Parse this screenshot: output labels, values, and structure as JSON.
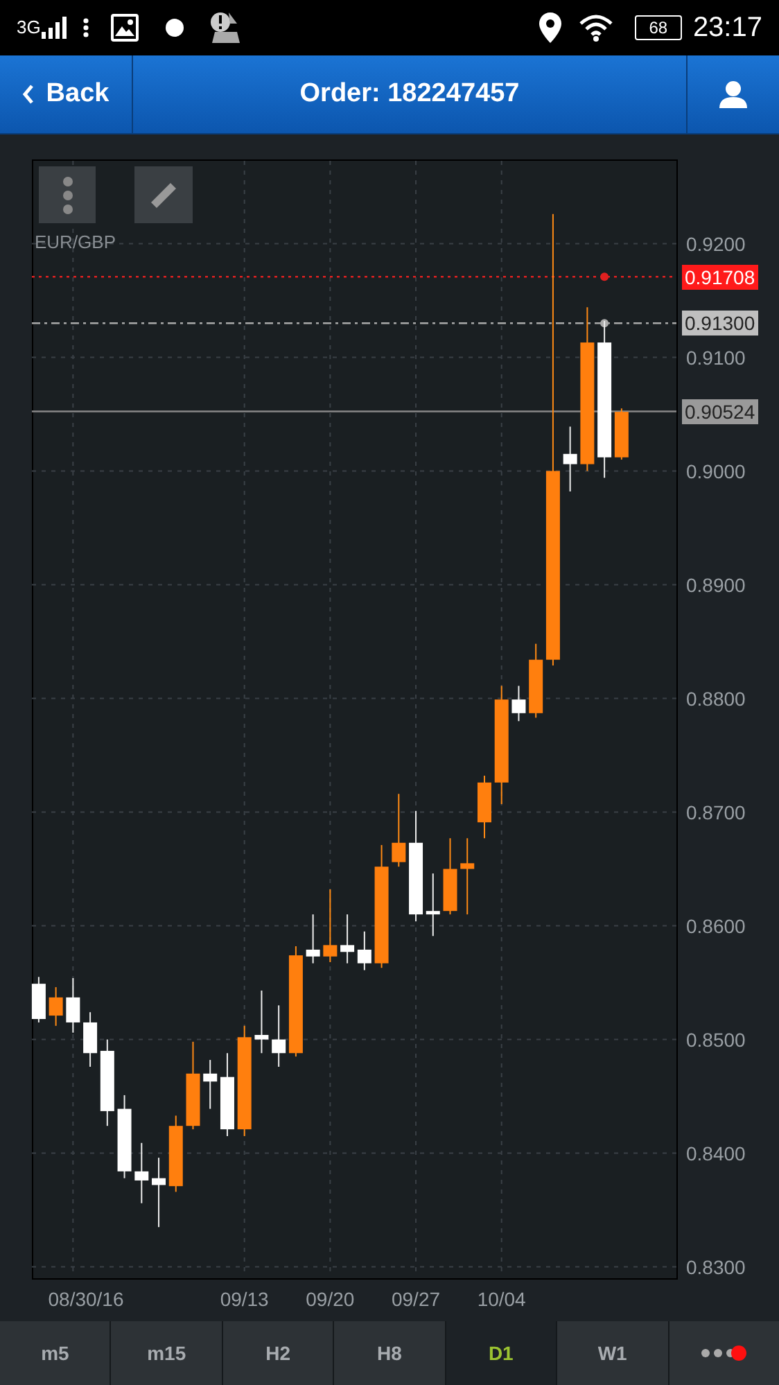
{
  "status_bar": {
    "network": "3G",
    "battery": "68",
    "time": "23:17"
  },
  "header": {
    "back": "Back",
    "title": "Order: 182247457"
  },
  "chart": {
    "symbol": "EUR/GBP",
    "price_markers": [
      {
        "label": "0.91708",
        "kind": "alert"
      },
      {
        "label": "0.91300",
        "kind": "order"
      },
      {
        "label": "0.90524",
        "kind": "current"
      }
    ],
    "chart_data": {
      "type": "candlestick",
      "ylim": [
        0.829,
        0.9274
      ],
      "grid": true,
      "categories": [
        null,
        null,
        "08/30/16",
        null,
        null,
        null,
        null,
        null,
        null,
        null,
        null,
        null,
        "09/13",
        null,
        null,
        null,
        null,
        "09/20",
        null,
        null,
        null,
        null,
        "09/27",
        null,
        null,
        null,
        null,
        "10/04",
        null,
        null,
        null,
        null,
        null,
        null,
        null
      ],
      "ref_lines": [
        {
          "axis": "y",
          "value": 0.91708,
          "color": "#e02020"
        },
        {
          "axis": "y",
          "value": 0.913,
          "color": "#aaaaaa"
        },
        {
          "axis": "y",
          "value": 0.90524,
          "color": "#888888"
        }
      ],
      "yticks": [
        {
          "value": 0.92,
          "label": "0.9200"
        },
        {
          "value": 0.91,
          "label": "0.9100"
        },
        {
          "value": 0.9,
          "label": "0.9000"
        },
        {
          "value": 0.89,
          "label": "0.8900"
        },
        {
          "value": 0.88,
          "label": "0.8800"
        },
        {
          "value": 0.87,
          "label": "0.8700"
        },
        {
          "value": 0.86,
          "label": "0.8600"
        },
        {
          "value": 0.85,
          "label": "0.8500"
        },
        {
          "value": 0.84,
          "label": "0.8400"
        },
        {
          "value": 0.83,
          "label": "0.8300"
        }
      ],
      "ohlc": [
        [
          0.8549,
          0.8555,
          0.8515,
          0.8518
        ],
        [
          0.8521,
          0.8546,
          0.8512,
          0.8537
        ],
        [
          0.8537,
          0.8554,
          0.8506,
          0.8515
        ],
        [
          0.8515,
          0.8524,
          0.8476,
          0.8488
        ],
        [
          0.849,
          0.85,
          0.8424,
          0.8437
        ],
        [
          0.8439,
          0.8451,
          0.8378,
          0.8384
        ],
        [
          0.8384,
          0.8409,
          0.8356,
          0.8376
        ],
        [
          0.8378,
          0.8396,
          0.8335,
          0.8372
        ],
        [
          0.8371,
          0.8433,
          0.8366,
          0.8424
        ],
        [
          0.8424,
          0.8498,
          0.8421,
          0.847
        ],
        [
          0.847,
          0.8482,
          0.8439,
          0.8463
        ],
        [
          0.8467,
          0.8488,
          0.8415,
          0.8421
        ],
        [
          0.8421,
          0.8512,
          0.8415,
          0.8502
        ],
        [
          0.8504,
          0.8543,
          0.8488,
          0.85
        ],
        [
          0.85,
          0.853,
          0.8476,
          0.8488
        ],
        [
          0.8488,
          0.8582,
          0.8485,
          0.8574
        ],
        [
          0.8579,
          0.861,
          0.8567,
          0.8573
        ],
        [
          0.8573,
          0.8632,
          0.8568,
          0.8583
        ],
        [
          0.8583,
          0.861,
          0.8567,
          0.8577
        ],
        [
          0.8579,
          0.8595,
          0.8561,
          0.8567
        ],
        [
          0.8567,
          0.8671,
          0.8563,
          0.8652
        ],
        [
          0.8656,
          0.8716,
          0.8652,
          0.8673
        ],
        [
          0.8673,
          0.8701,
          0.8604,
          0.861
        ],
        [
          0.8613,
          0.8646,
          0.8591,
          0.861
        ],
        [
          0.8613,
          0.8677,
          0.861,
          0.865
        ],
        [
          0.865,
          0.8677,
          0.861,
          0.8655
        ],
        [
          0.8691,
          0.8732,
          0.8677,
          0.8726
        ],
        [
          0.8726,
          0.8811,
          0.8707,
          0.8799
        ],
        [
          0.8799,
          0.8811,
          0.878,
          0.8787
        ],
        [
          0.8787,
          0.8848,
          0.8783,
          0.8834
        ],
        [
          0.8834,
          0.9226,
          0.8829,
          0.9
        ],
        [
          0.9015,
          0.9039,
          0.8982,
          0.9006
        ],
        [
          0.9006,
          0.9144,
          0.9,
          0.9113
        ],
        [
          0.9113,
          0.9132,
          0.8994,
          0.9012
        ],
        [
          0.9012,
          0.9055,
          0.901,
          0.9052
        ]
      ]
    }
  },
  "timeframes": [
    {
      "label": "m5",
      "selected": false
    },
    {
      "label": "m15",
      "selected": false
    },
    {
      "label": "H2",
      "selected": false
    },
    {
      "label": "H8",
      "selected": false
    },
    {
      "label": "D1",
      "selected": true
    },
    {
      "label": "W1",
      "selected": false
    }
  ],
  "more_tab": {
    "alert": true
  }
}
